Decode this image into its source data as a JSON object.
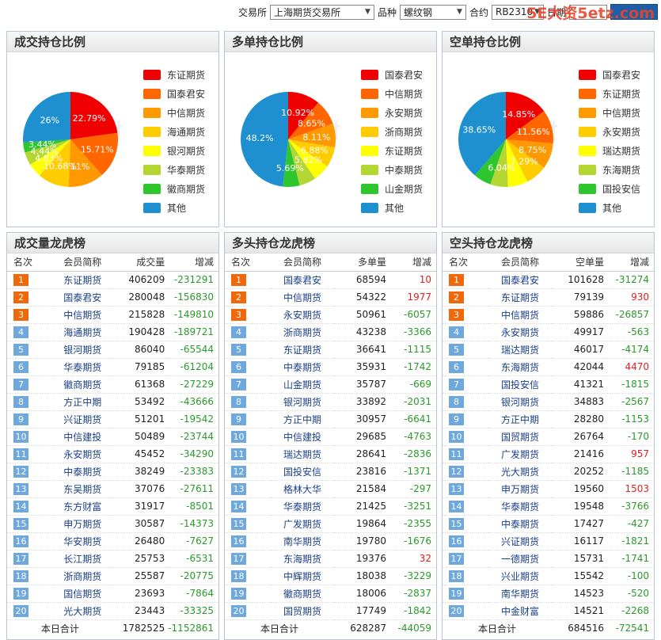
{
  "toolbar": {
    "exchange_label": "交易所",
    "exchange_value": "上海期货交易所",
    "variety_label": "品种",
    "variety_value": "螺纹钢",
    "contract_label": "合约",
    "contract_value": "RB2310",
    "date_label": "日期",
    "date_value": "",
    "query_label": ""
  },
  "watermark": "5E大资5etz.com",
  "pie_watermark": "财",
  "colors": [
    "#f00000",
    "#ff6600",
    "#ff9900",
    "#ffcc00",
    "#ffff00",
    "#b3d633",
    "#2ec62e",
    "#1e8fcf"
  ],
  "pies": [
    {
      "title": "成交持仓比例",
      "legend": [
        "东证期货",
        "国泰君安",
        "中信期货",
        "海通期货",
        "银河期货",
        "华泰期货",
        "徽商期货",
        "其他"
      ],
      "chart_data": {
        "type": "pie",
        "labels": [
          "东证期货",
          "国泰君安",
          "中信期货",
          "海通期货",
          "银河期货",
          "华泰期货",
          "徽商期货",
          "其他"
        ],
        "values": [
          22.79,
          15.71,
          12.11,
          10.68,
          4.83,
          4.44,
          3.44,
          26.0
        ],
        "display_labels": [
          "22.79%",
          "15.71%",
          "11%",
          "10.68%",
          "4.83%",
          "4.44%",
          "3.44%",
          "26%"
        ]
      }
    },
    {
      "title": "多单持仓比例",
      "legend": [
        "国泰君安",
        "中信期货",
        "永安期货",
        "浙商期货",
        "东证期货",
        "中泰期货",
        "山金期货",
        "其他"
      ],
      "chart_data": {
        "type": "pie",
        "labels": [
          "国泰君安",
          "中信期货",
          "永安期货",
          "浙商期货",
          "东证期货",
          "中泰期货",
          "山金期货",
          "其他"
        ],
        "values": [
          10.92,
          8.65,
          8.11,
          6.88,
          5.82,
          5.69,
          5.69,
          48.2
        ],
        "display_labels": [
          "10.92%",
          "8.65%",
          "8.11%",
          "6.88%",
          "5.82%",
          "",
          "5.69%",
          "48.2%"
        ]
      }
    },
    {
      "title": "空单持仓比例",
      "legend": [
        "国泰君安",
        "东证期货",
        "中信期货",
        "永安期货",
        "瑞达期货",
        "东海期货",
        "国投安信",
        "其他"
      ],
      "chart_data": {
        "type": "pie",
        "labels": [
          "国泰君安",
          "东证期货",
          "中信期货",
          "永安期货",
          "瑞达期货",
          "东海期货",
          "国投安信",
          "其他"
        ],
        "values": [
          14.85,
          11.56,
          8.75,
          7.29,
          6.8,
          6.04,
          6.06,
          38.65
        ],
        "display_labels": [
          "14.85%",
          "11.56%",
          "8.75%",
          "7.29%",
          "",
          "6.04%",
          "",
          "38.65%"
        ]
      }
    }
  ],
  "tables": [
    {
      "title": "成交量龙虎榜",
      "headers": [
        "名次",
        "会员简称",
        "成交量",
        "增减"
      ],
      "rows": [
        [
          "1",
          "东证期货",
          "406209",
          "-231291"
        ],
        [
          "2",
          "国泰君安",
          "280048",
          "-156830"
        ],
        [
          "3",
          "中信期货",
          "215828",
          "-149810"
        ],
        [
          "4",
          "海通期货",
          "190428",
          "-189721"
        ],
        [
          "5",
          "银河期货",
          "86040",
          "-65544"
        ],
        [
          "6",
          "华泰期货",
          "79185",
          "-61204"
        ],
        [
          "7",
          "徽商期货",
          "61368",
          "-27229"
        ],
        [
          "8",
          "方正中期",
          "53492",
          "-43666"
        ],
        [
          "9",
          "兴证期货",
          "51201",
          "-19542"
        ],
        [
          "10",
          "中信建投",
          "50489",
          "-23744"
        ],
        [
          "11",
          "永安期货",
          "45452",
          "-34290"
        ],
        [
          "12",
          "中泰期货",
          "38249",
          "-23383"
        ],
        [
          "13",
          "东吴期货",
          "37076",
          "-27611"
        ],
        [
          "14",
          "东方财富",
          "31917",
          "-8501"
        ],
        [
          "15",
          "申万期货",
          "30587",
          "-14373"
        ],
        [
          "16",
          "华安期货",
          "26480",
          "-7627"
        ],
        [
          "17",
          "长江期货",
          "25753",
          "-6531"
        ],
        [
          "18",
          "浙商期货",
          "25587",
          "-20775"
        ],
        [
          "19",
          "国信期货",
          "23693",
          "-7864"
        ],
        [
          "20",
          "光大期货",
          "23443",
          "-33325"
        ]
      ],
      "total": {
        "label": "本日合计",
        "value": "1782525",
        "change": "-1152861"
      }
    },
    {
      "title": "多头持仓龙虎榜",
      "headers": [
        "名次",
        "会员简称",
        "多单量",
        "增减"
      ],
      "rows": [
        [
          "1",
          "国泰君安",
          "68594",
          "10"
        ],
        [
          "2",
          "中信期货",
          "54322",
          "1977"
        ],
        [
          "3",
          "永安期货",
          "50961",
          "-6057"
        ],
        [
          "4",
          "浙商期货",
          "43238",
          "-3366"
        ],
        [
          "5",
          "东证期货",
          "36641",
          "-1115"
        ],
        [
          "6",
          "中泰期货",
          "35931",
          "-1742"
        ],
        [
          "7",
          "山金期货",
          "35787",
          "-669"
        ],
        [
          "8",
          "银河期货",
          "33892",
          "-2031"
        ],
        [
          "9",
          "方正中期",
          "30957",
          "-6641"
        ],
        [
          "10",
          "中信建投",
          "29685",
          "-4763"
        ],
        [
          "11",
          "瑞达期货",
          "28641",
          "-2836"
        ],
        [
          "12",
          "国投安信",
          "23816",
          "-1371"
        ],
        [
          "13",
          "格林大华",
          "21584",
          "-297"
        ],
        [
          "14",
          "华泰期货",
          "21425",
          "-3251"
        ],
        [
          "15",
          "广发期货",
          "19864",
          "-2355"
        ],
        [
          "16",
          "南华期货",
          "19780",
          "-1676"
        ],
        [
          "17",
          "东海期货",
          "19376",
          "32"
        ],
        [
          "18",
          "中辉期货",
          "18038",
          "-3229"
        ],
        [
          "19",
          "徽商期货",
          "18006",
          "-2837"
        ],
        [
          "20",
          "国贸期货",
          "17749",
          "-1842"
        ]
      ],
      "total": {
        "label": "本日合计",
        "value": "628287",
        "change": "-44059"
      }
    },
    {
      "title": "空头持仓龙虎榜",
      "headers": [
        "名次",
        "会员简称",
        "空单量",
        "增减"
      ],
      "rows": [
        [
          "1",
          "国泰君安",
          "101628",
          "-31274"
        ],
        [
          "2",
          "东证期货",
          "79139",
          "930"
        ],
        [
          "3",
          "中信期货",
          "59886",
          "-26857"
        ],
        [
          "4",
          "永安期货",
          "49917",
          "-563"
        ],
        [
          "5",
          "瑞达期货",
          "46017",
          "-4174"
        ],
        [
          "6",
          "东海期货",
          "42044",
          "4470"
        ],
        [
          "7",
          "国投安信",
          "41321",
          "-1815"
        ],
        [
          "8",
          "银河期货",
          "34883",
          "-2567"
        ],
        [
          "9",
          "方正中期",
          "28280",
          "-1153"
        ],
        [
          "10",
          "国贸期货",
          "26764",
          "-170"
        ],
        [
          "11",
          "广发期货",
          "21416",
          "957"
        ],
        [
          "12",
          "光大期货",
          "20252",
          "-1185"
        ],
        [
          "13",
          "申万期货",
          "19560",
          "1503"
        ],
        [
          "14",
          "华泰期货",
          "19548",
          "-3766"
        ],
        [
          "15",
          "中泰期货",
          "17427",
          "-427"
        ],
        [
          "16",
          "兴证期货",
          "16117",
          "-1821"
        ],
        [
          "17",
          "一德期货",
          "15731",
          "-1741"
        ],
        [
          "18",
          "兴业期货",
          "15542",
          "-100"
        ],
        [
          "19",
          "南华期货",
          "14523",
          "-520"
        ],
        [
          "20",
          "中金财富",
          "14521",
          "-2268"
        ]
      ],
      "total": {
        "label": "本日合计",
        "value": "684516",
        "change": "-72541"
      }
    }
  ]
}
